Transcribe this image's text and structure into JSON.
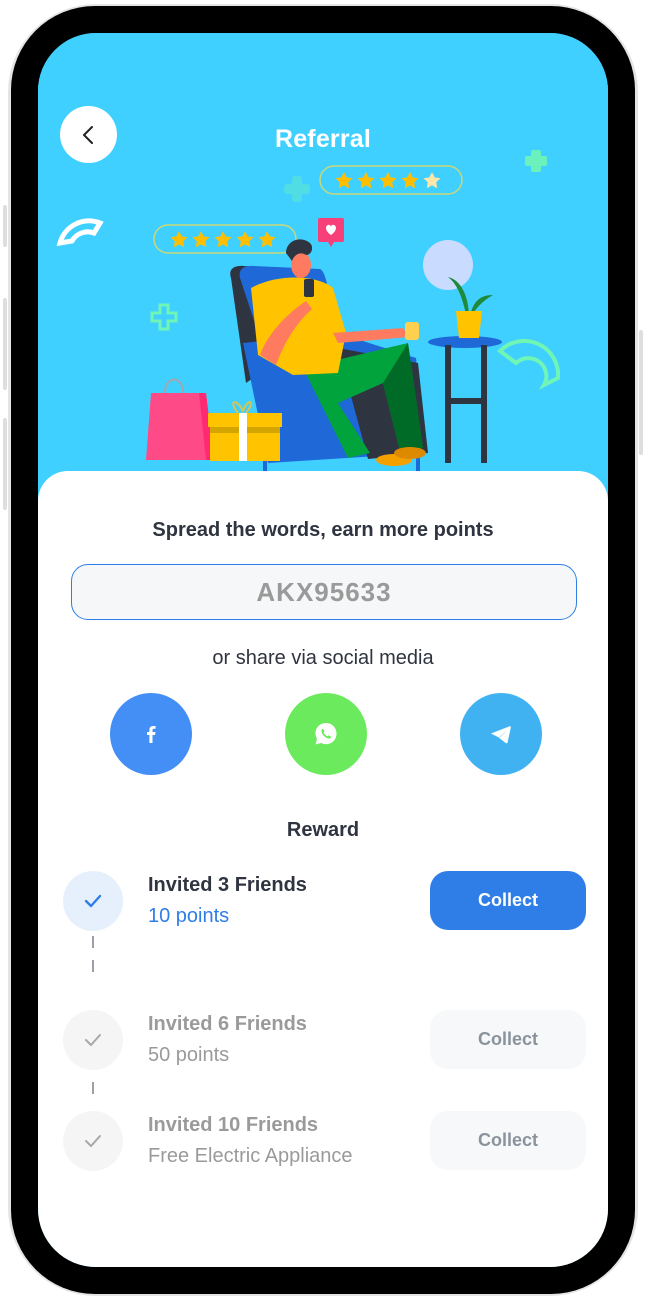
{
  "header": {
    "title": "Referral",
    "back_icon": "chevron-left-icon"
  },
  "illustration": {
    "rating_badges": [
      {
        "filled_stars": 4,
        "total_stars": 5
      },
      {
        "filled_stars": 5,
        "total_stars": 5
      }
    ],
    "elements": [
      "man-in-armchair",
      "phone",
      "heart-notification",
      "shopping-bag",
      "gift-box",
      "side-table",
      "potted-plant",
      "decorative-shapes"
    ]
  },
  "referral": {
    "tagline": "Spread the words, earn more points",
    "code": "AKX95633",
    "share_text": "or share via social media",
    "social": [
      {
        "name": "Facebook",
        "icon": "facebook-icon",
        "color": "#448ff5"
      },
      {
        "name": "WhatsApp",
        "icon": "whatsapp-icon",
        "color": "#6bea5e"
      },
      {
        "name": "Telegram",
        "icon": "telegram-icon",
        "color": "#41b2f1"
      }
    ]
  },
  "reward": {
    "title": "Reward",
    "items": [
      {
        "title": "Invited 3 Friends",
        "subtitle": "10 points",
        "button": "Collect",
        "active": true
      },
      {
        "title": "Invited 6 Friends",
        "subtitle": "50 points",
        "button": "Collect",
        "active": false
      },
      {
        "title": "Invited 10 Friends",
        "subtitle": "Free Electric Appliance",
        "button": "Collect",
        "active": false
      }
    ]
  },
  "colors": {
    "hero_bg": "#40d0ff",
    "primary": "#2f7ee8",
    "text_dark": "#2f3440",
    "text_muted": "#9a9a9a"
  }
}
